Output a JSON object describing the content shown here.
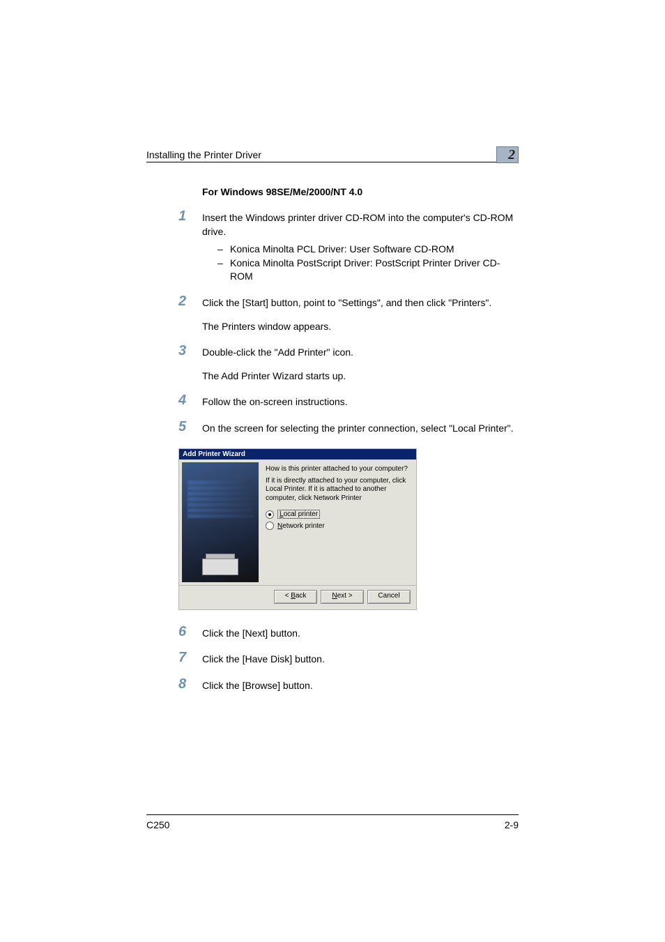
{
  "header": {
    "title": "Installing the Printer Driver",
    "chapter_number": "2"
  },
  "section_heading": "For Windows 98SE/Me/2000/NT 4.0",
  "steps": {
    "s1": {
      "num": "1",
      "text": "Insert the Windows printer driver CD-ROM into the computer's CD-ROM drive."
    },
    "sub1": {
      "a": "Konica Minolta PCL Driver: User Software CD-ROM",
      "b": "Konica Minolta PostScript Driver: PostScript Printer Driver CD-ROM"
    },
    "s2": {
      "num": "2",
      "text": "Click the [Start] button, point to \"Settings\", and then click \"Printers\".",
      "result": "The Printers window appears."
    },
    "s3": {
      "num": "3",
      "text": "Double-click the \"Add Printer\" icon.",
      "result": "The Add Printer Wizard starts up."
    },
    "s4": {
      "num": "4",
      "text": "Follow the on-screen instructions."
    },
    "s5": {
      "num": "5",
      "text": "On the screen for selecting the printer connection, select \"Local Printer\"."
    },
    "s6": {
      "num": "6",
      "text": "Click the [Next] button."
    },
    "s7": {
      "num": "7",
      "text": "Click the [Have Disk] button."
    },
    "s8": {
      "num": "8",
      "text": "Click the [Browse] button."
    }
  },
  "wizard": {
    "title": "Add Printer Wizard",
    "question": "How is this printer attached to your computer?",
    "explain": "If it is directly attached to your computer, click Local Printer. If it is attached to another computer, click Network Printer",
    "radio_local_prefix": "L",
    "radio_local_rest": "ocal printer",
    "radio_network_prefix": "N",
    "radio_network_rest": "etwork printer",
    "btn_back_prefix": "< ",
    "btn_back_u": "B",
    "btn_back_rest": "ack",
    "btn_next_prefix": "",
    "btn_next_u": "N",
    "btn_next_rest": "ext >",
    "btn_cancel": "Cancel"
  },
  "footer": {
    "left": "C250",
    "right": "2-9"
  }
}
